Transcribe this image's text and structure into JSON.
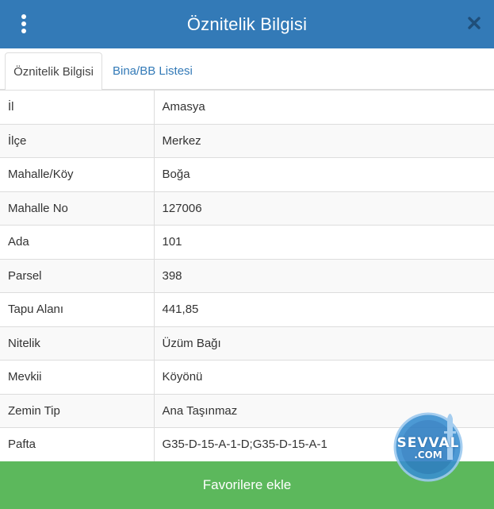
{
  "header": {
    "title": "Öznitelik Bilgisi",
    "menu_icon": "vertical-ellipsis-icon",
    "close_icon": "close-icon"
  },
  "tabs": [
    {
      "label": "Öznitelik Bilgisi",
      "active": true
    },
    {
      "label": "Bina/BB Listesi",
      "active": false
    }
  ],
  "attributes": [
    {
      "key": "İl",
      "value": "Amasya"
    },
    {
      "key": "İlçe",
      "value": "Merkez"
    },
    {
      "key": "Mahalle/Köy",
      "value": "Boğa"
    },
    {
      "key": "Mahalle No",
      "value": "127006"
    },
    {
      "key": "Ada",
      "value": "101"
    },
    {
      "key": "Parsel",
      "value": "398"
    },
    {
      "key": "Tapu Alanı",
      "value": "441,85"
    },
    {
      "key": "Nitelik",
      "value": "Üzüm Bağı"
    },
    {
      "key": "Mevkii",
      "value": "Köyönü"
    },
    {
      "key": "Zemin Tip",
      "value": "Ana Taşınmaz"
    },
    {
      "key": "Pafta",
      "value": "G35-D-15-A-1-D;G35-D-15-A-1"
    }
  ],
  "footer": {
    "favorite_label": "Favorilere ekle"
  },
  "watermark": {
    "main": "SEVVAL",
    "sub": ".COM"
  },
  "colors": {
    "header_bg": "#337ab7",
    "button_green": "#5cb85c",
    "link_blue": "#337ab7"
  }
}
